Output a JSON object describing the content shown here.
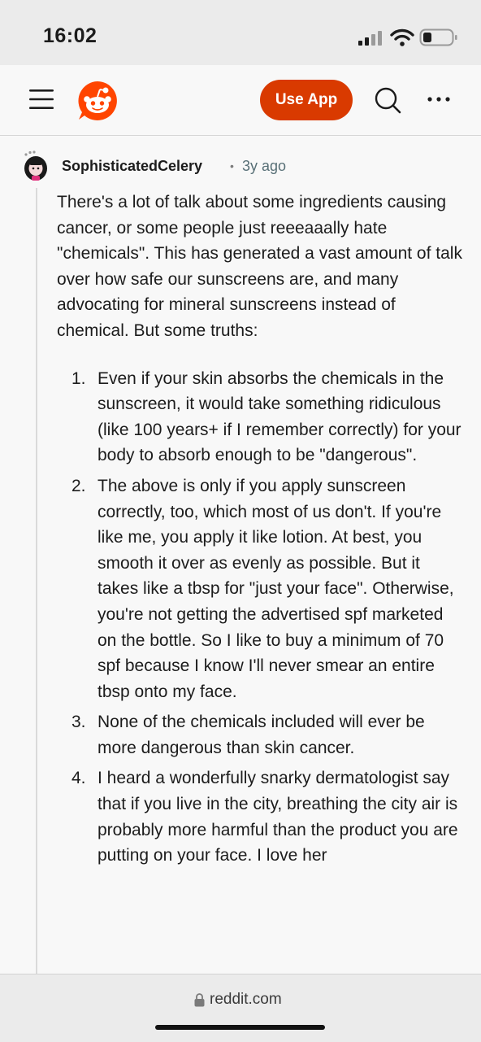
{
  "status_bar": {
    "time": "16:02"
  },
  "header": {
    "use_app_label": "Use App",
    "accent_color": "#d93a00",
    "logo_color": "#ff4500"
  },
  "comment": {
    "author": "SophisticatedCelery",
    "separator": "•",
    "timestamp": "3y ago",
    "intro": "There's a lot of talk about some ingredients causing cancer, or some people just reeeaaally hate \"chemicals\". This has generated a vast amount of talk over how safe our sunscreens are, and many advocating for mineral sunscreens instead of chemical. But some truths:",
    "list": [
      {
        "number": "1.",
        "text": "Even if your skin absorbs the chemicals in the sunscreen, it would take something ridiculous (like 100 years+ if I remember correctly) for your body to absorb enough to be \"dangerous\"."
      },
      {
        "number": "2.",
        "text": "The above is only if you apply sunscreen correctly, too, which most of us don't. If you're like me, you apply it like lotion. At best, you smooth it over as evenly as possible. But it takes like a tbsp for \"just your face\". Otherwise, you're not getting the advertised spf marketed on the bottle. So I like to buy a minimum of 70 spf because I know I'll never smear an entire tbsp onto my face."
      },
      {
        "number": "3.",
        "text": "None of the chemicals included will ever be more dangerous than skin cancer."
      },
      {
        "number": "4.",
        "text": "I heard a wonderfully snarky dermatologist say that if you live in the city, breathing the city air is probably more harmful than the product you are putting on your face. I love her"
      }
    ]
  },
  "browser": {
    "url": "reddit.com"
  },
  "icons": {
    "menu": "hamburger-menu-icon",
    "logo": "reddit-logo",
    "search": "search-icon",
    "more": "more-horizontal-icon",
    "lock": "lock-icon",
    "signal": "cellular-signal-icon",
    "wifi": "wifi-icon",
    "battery": "battery-icon"
  }
}
